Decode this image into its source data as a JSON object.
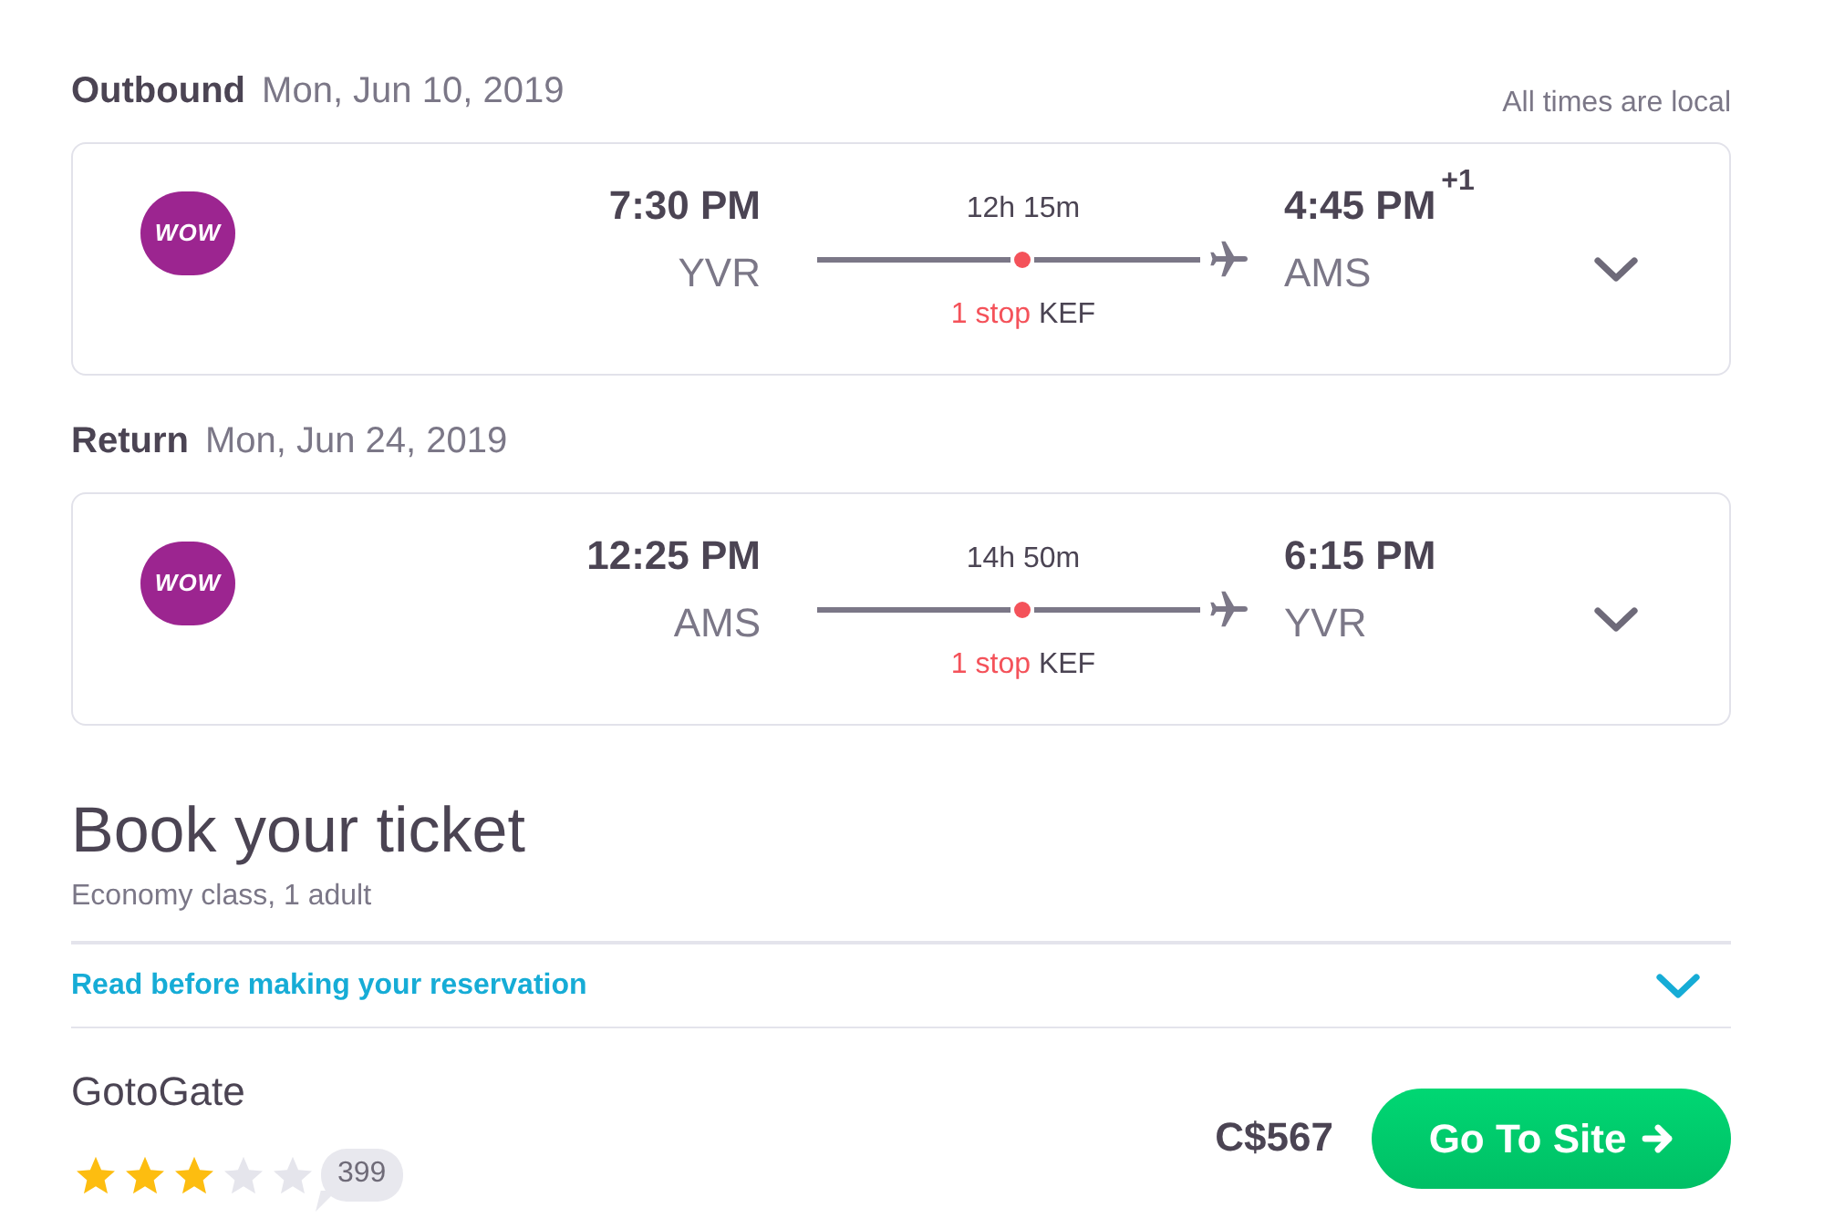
{
  "legs": [
    {
      "label": "Outbound",
      "date": "Mon, Jun 10, 2019",
      "note": "All times are local",
      "airline": {
        "logo_text": "WOW"
      },
      "departure": {
        "time": "7:30 PM",
        "airport": "YVR"
      },
      "duration": "12h 15m",
      "stops": {
        "count": "1 stop",
        "via": "KEF"
      },
      "arrival": {
        "time": "4:45 PM",
        "day_offset": "+1",
        "airport": "AMS"
      },
      "expanded": false
    },
    {
      "label": "Return",
      "date": "Mon, Jun 24, 2019",
      "airline": {
        "logo_text": "WOW"
      },
      "departure": {
        "time": "12:25 PM",
        "airport": "AMS"
      },
      "duration": "14h 50m",
      "stops": {
        "count": "1 stop",
        "via": "KEF"
      },
      "arrival": {
        "time": "6:15 PM",
        "airport": "YVR"
      },
      "expanded": false
    }
  ],
  "booking": {
    "title": "Book your ticket",
    "subtitle": "Economy class, 1 adult",
    "notice": {
      "label": "Read before making your reservation",
      "expanded": false
    },
    "offer": {
      "provider": "GotoGate",
      "stars": 3,
      "review_count": "399",
      "price": "C$567",
      "button": "Go To Site"
    }
  }
}
